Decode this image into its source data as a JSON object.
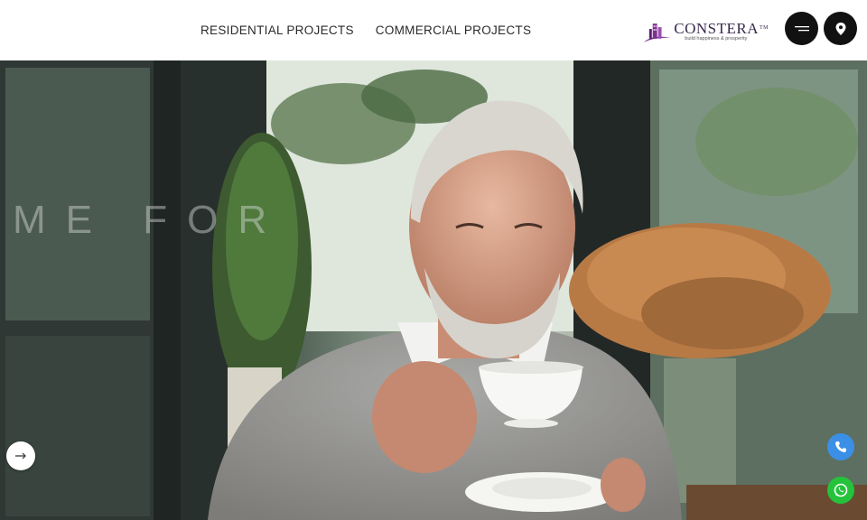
{
  "header": {
    "nav": [
      {
        "label": "RESIDENTIAL PROJECTS"
      },
      {
        "label": "COMMERCIAL PROJECTS"
      }
    ],
    "logo": {
      "name": "CONSTERA",
      "trademark": "TM",
      "tagline": "build happiness & prosperity"
    },
    "menu_icon": "hamburger-icon",
    "location_icon": "map-pin-icon"
  },
  "hero": {
    "overlay_text": "ME FOR",
    "image_subject": "elderly man drinking from a teacup"
  },
  "floating": {
    "next_icon": "arrow-right-icon",
    "phone_icon": "phone-icon",
    "whatsapp_icon": "whatsapp-icon"
  },
  "colors": {
    "brand_purple": "#7b2f8f",
    "button_dark": "#111111",
    "phone_blue": "#3b8fe6",
    "whatsapp_green": "#25c23c"
  }
}
